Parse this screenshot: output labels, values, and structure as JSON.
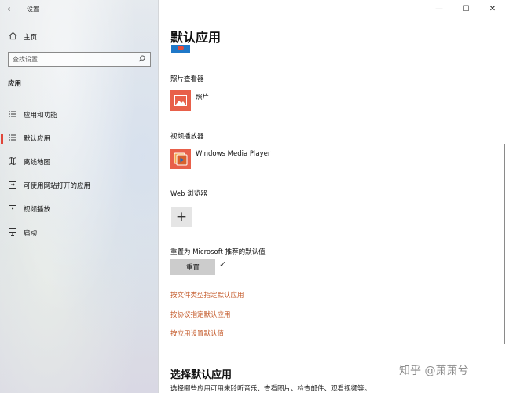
{
  "window": {
    "title": "设置",
    "controls": {
      "minimize": "—",
      "maximize": "☐",
      "close": "✕"
    }
  },
  "sidebar": {
    "back_icon": "←",
    "home": {
      "icon": "home-icon",
      "label": "主页"
    },
    "search": {
      "placeholder": "查找设置"
    },
    "section_title": "应用",
    "items": [
      {
        "id": "apps-features",
        "icon": "list-icon",
        "label": "应用和功能",
        "active": false
      },
      {
        "id": "default-apps",
        "icon": "list-icon",
        "label": "默认应用",
        "active": true
      },
      {
        "id": "offline-maps",
        "icon": "map-icon",
        "label": "离线地图",
        "active": false
      },
      {
        "id": "apps-for-websites",
        "icon": "web-icon",
        "label": "可使用网站打开的应用",
        "active": false
      },
      {
        "id": "video-playback",
        "icon": "video-icon",
        "label": "视频播放",
        "active": false
      },
      {
        "id": "startup",
        "icon": "startup-icon",
        "label": "启动",
        "active": false
      }
    ]
  },
  "main": {
    "page_title": "默认应用",
    "groups": [
      {
        "label": "照片查看器",
        "app_name": "照片",
        "icon": "photos-icon",
        "color": "#e8604a"
      },
      {
        "label": "视频播放器",
        "app_name": "Windows Media Player",
        "icon": "media-player-icon",
        "color": "#e8604a"
      },
      {
        "label": "Web 浏览器",
        "app_name": "",
        "icon": "plus-icon"
      }
    ],
    "reset": {
      "label": "重置为 Microsoft 推荐的默认值",
      "button": "重置",
      "check": "✓"
    },
    "links": [
      "按文件类型指定默认应用",
      "按协议指定默认应用",
      "按应用设置默认值"
    ],
    "choose_section": {
      "title": "选择默认应用",
      "description": "选择哪些应用可用来聆听音乐、查看图片、检查邮件、观看视频等。"
    }
  },
  "watermark": "知乎 @萧萧兮",
  "colors": {
    "accent": "#e0463a",
    "link": "#c45a2a",
    "tile": "#e8604a"
  }
}
